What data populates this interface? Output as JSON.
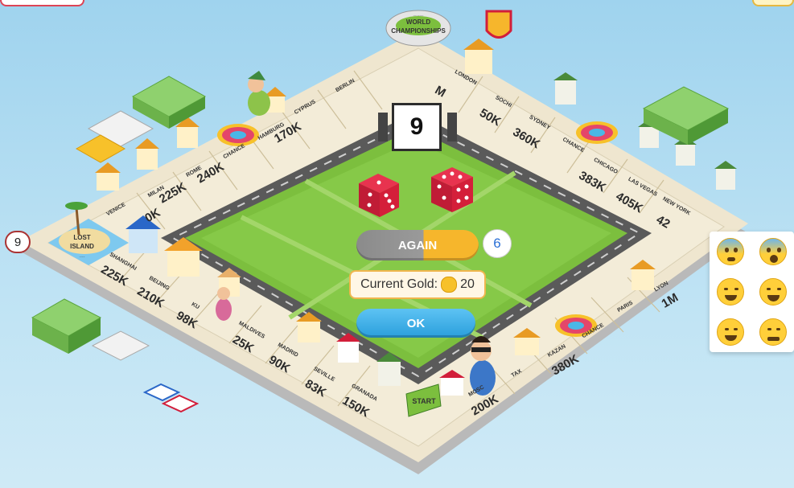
{
  "dice_total": "9",
  "lost_island_counter": "9",
  "again_button": {
    "label": "AGAIN",
    "remaining": "6"
  },
  "gold": {
    "label": "Current Gold:",
    "amount": "20"
  },
  "ok_button": {
    "label": "OK"
  },
  "board": {
    "corners": {
      "top": "WORLD CHAMPIONSHIPS",
      "left": "LOST ISLAND",
      "bottom": "START"
    },
    "top_left_edge": [
      {
        "name": "VENICE",
        "price": ""
      },
      {
        "name": "MILAN",
        "price": "225K"
      },
      {
        "name": "ROME",
        "price": "240K"
      },
      {
        "name": "CHANCE",
        "price": ""
      },
      {
        "name": "HAMBURG",
        "price": "170K"
      },
      {
        "name": "CYPRUS",
        "price": ""
      },
      {
        "name": "BERLIN",
        "price": ""
      }
    ],
    "top_right_edge": [
      {
        "name": "LONDON",
        "price": ""
      },
      {
        "name": "SOCHI",
        "price": "50K"
      },
      {
        "name": "SYDNEY",
        "price": "360K"
      },
      {
        "name": "CHANCE",
        "price": ""
      },
      {
        "name": "CHICAGO",
        "price": "383K"
      },
      {
        "name": "LAS VEGAS",
        "price": "405K"
      },
      {
        "name": "NEW YORK",
        "price": "42"
      }
    ],
    "bottom_left_edge": [
      {
        "name": "SHANGHAI",
        "price": "225K"
      },
      {
        "name": "BEIJING",
        "price": "210K"
      },
      {
        "name": "KU",
        "price": "98K"
      },
      {
        "name": "MALDIVES",
        "price": "25K"
      },
      {
        "name": "MADRID",
        "price": "90K"
      },
      {
        "name": "SEVILLE",
        "price": "83K"
      },
      {
        "name": "GRANADA",
        "price": "150K"
      }
    ],
    "bottom_right_edge": [
      {
        "name": "MOSC",
        "price": "200K"
      },
      {
        "name": "TAX",
        "price": ""
      },
      {
        "name": "KAZAN",
        "price": "380K"
      },
      {
        "name": "CHANCE",
        "price": ""
      },
      {
        "name": "PARIS",
        "price": ""
      },
      {
        "name": "LYON",
        "price": "1M"
      }
    ],
    "partial_price": "M",
    "left_partial": "0K"
  },
  "emoji_panel": [
    "fearful",
    "screaming",
    "laughing-tears",
    "crying",
    "grinning",
    "angry"
  ],
  "colors": {
    "grass": "#7cbf3e",
    "road": "#5a5a5a",
    "tile": "#f3ecd8",
    "dice": "#d41f3a",
    "sky": "#a9d8f0",
    "again_gold": "#f6b62c",
    "ok_blue": "#2a9fdc"
  }
}
